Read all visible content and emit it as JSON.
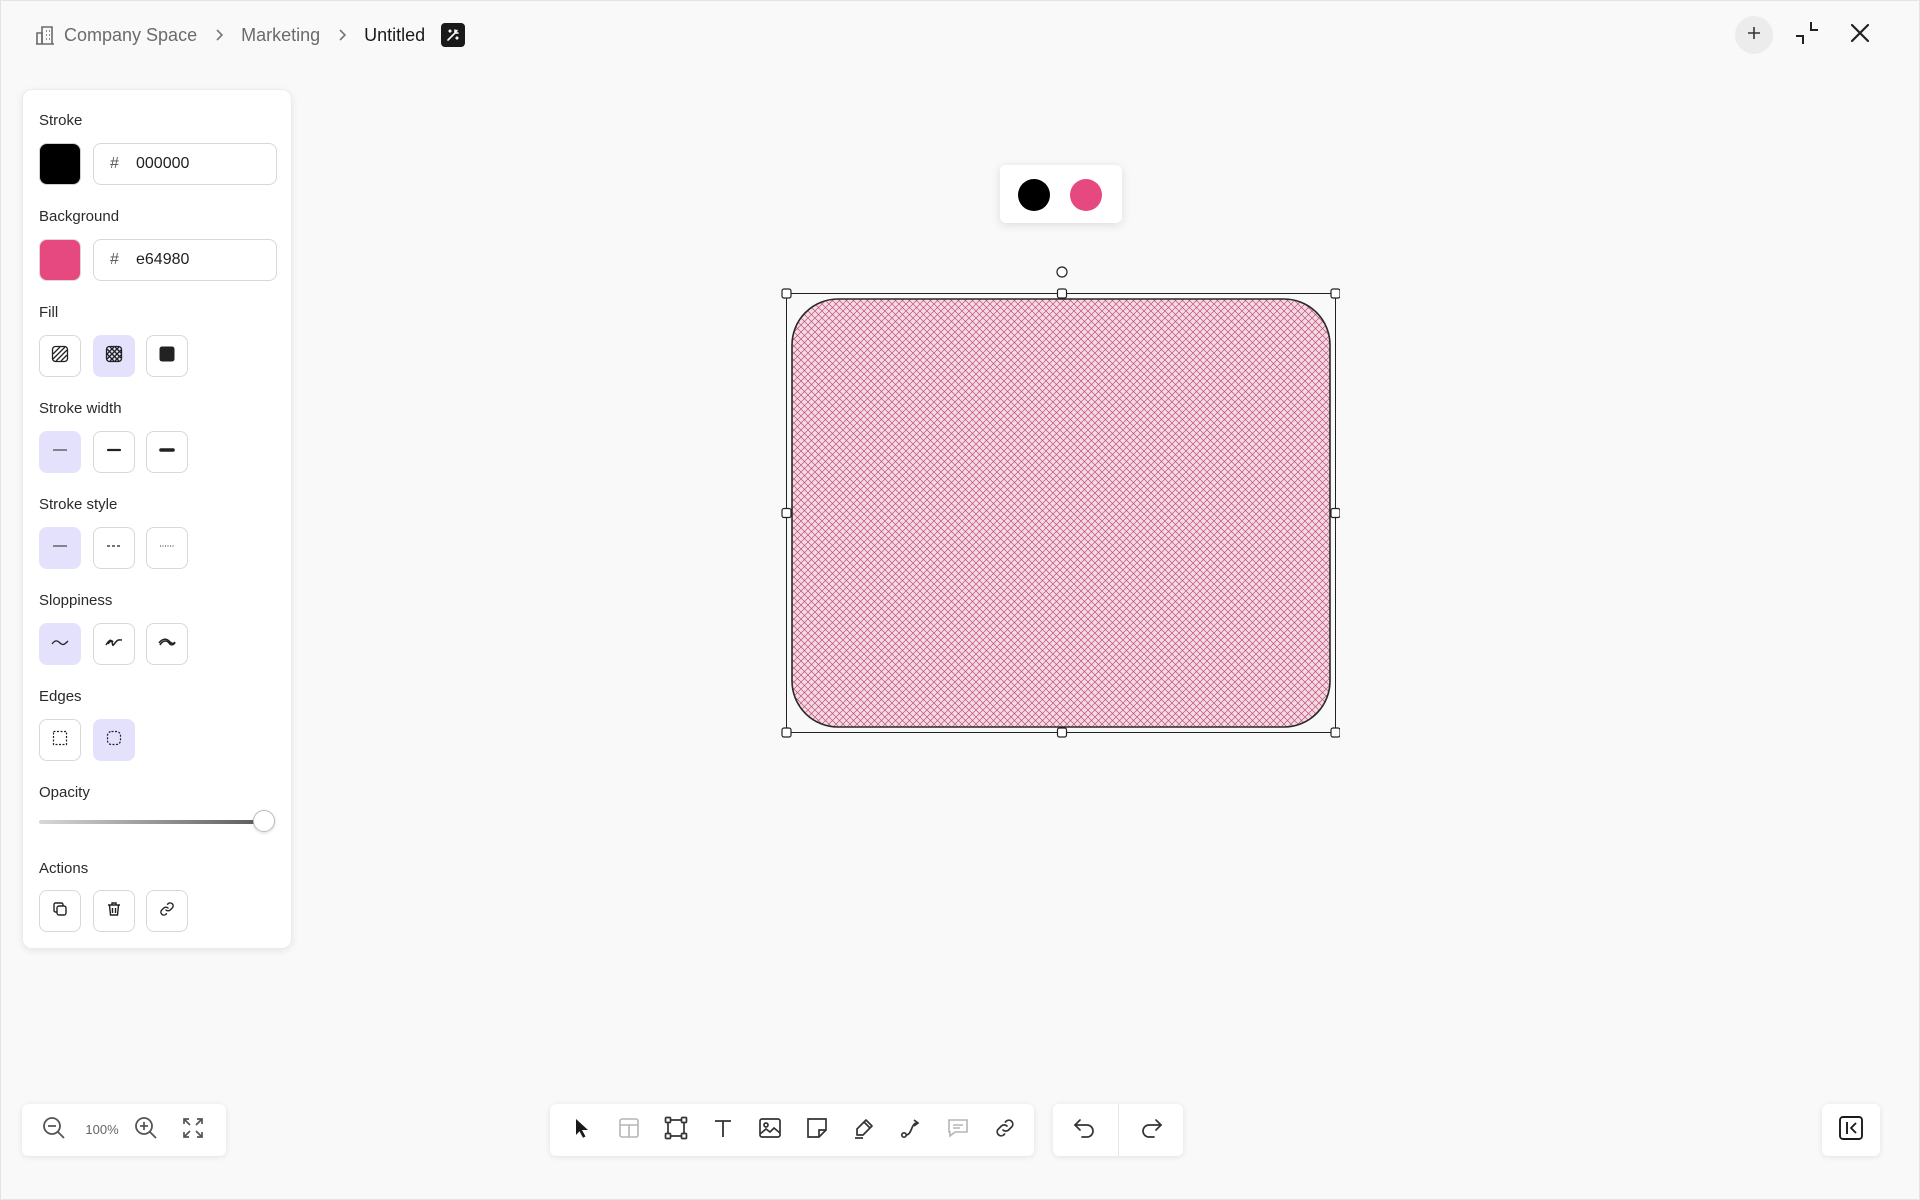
{
  "breadcrumb": {
    "space": "Company Space",
    "folder": "Marketing",
    "document": "Untitled"
  },
  "panel": {
    "stroke_label": "Stroke",
    "stroke_hex": "000000",
    "stroke_color": "#000000",
    "background_label": "Background",
    "background_hex": "e64980",
    "background_color": "#e64980",
    "hash_symbol": "#",
    "fill_label": "Fill",
    "fill_options": [
      "hachure",
      "cross-hatch",
      "solid"
    ],
    "fill_selected": "cross-hatch",
    "stroke_width_label": "Stroke width",
    "stroke_width_options": [
      "thin",
      "bold",
      "extra-bold"
    ],
    "stroke_width_selected": "thin",
    "stroke_style_label": "Stroke style",
    "stroke_style_options": [
      "solid",
      "dashed",
      "dotted"
    ],
    "stroke_style_selected": "solid",
    "sloppiness_label": "Sloppiness",
    "sloppiness_options": [
      "architect",
      "artist",
      "cartoonist"
    ],
    "sloppiness_selected": "architect",
    "edges_label": "Edges",
    "edges_options": [
      "sharp",
      "round"
    ],
    "edges_selected": "round",
    "opacity_label": "Opacity",
    "opacity_value": 100,
    "actions_label": "Actions",
    "actions": [
      "duplicate",
      "delete",
      "link"
    ]
  },
  "color_popup": [
    "#000000",
    "#e64980"
  ],
  "zoom": {
    "level": "100%"
  },
  "toolbar_tools": [
    "select",
    "frame",
    "shape",
    "text",
    "image",
    "sticky-note",
    "pen",
    "connector",
    "comment",
    "embed-link"
  ],
  "colors": {
    "accent_active": "#e3e1fb",
    "canvas": "#f9f9f9"
  }
}
